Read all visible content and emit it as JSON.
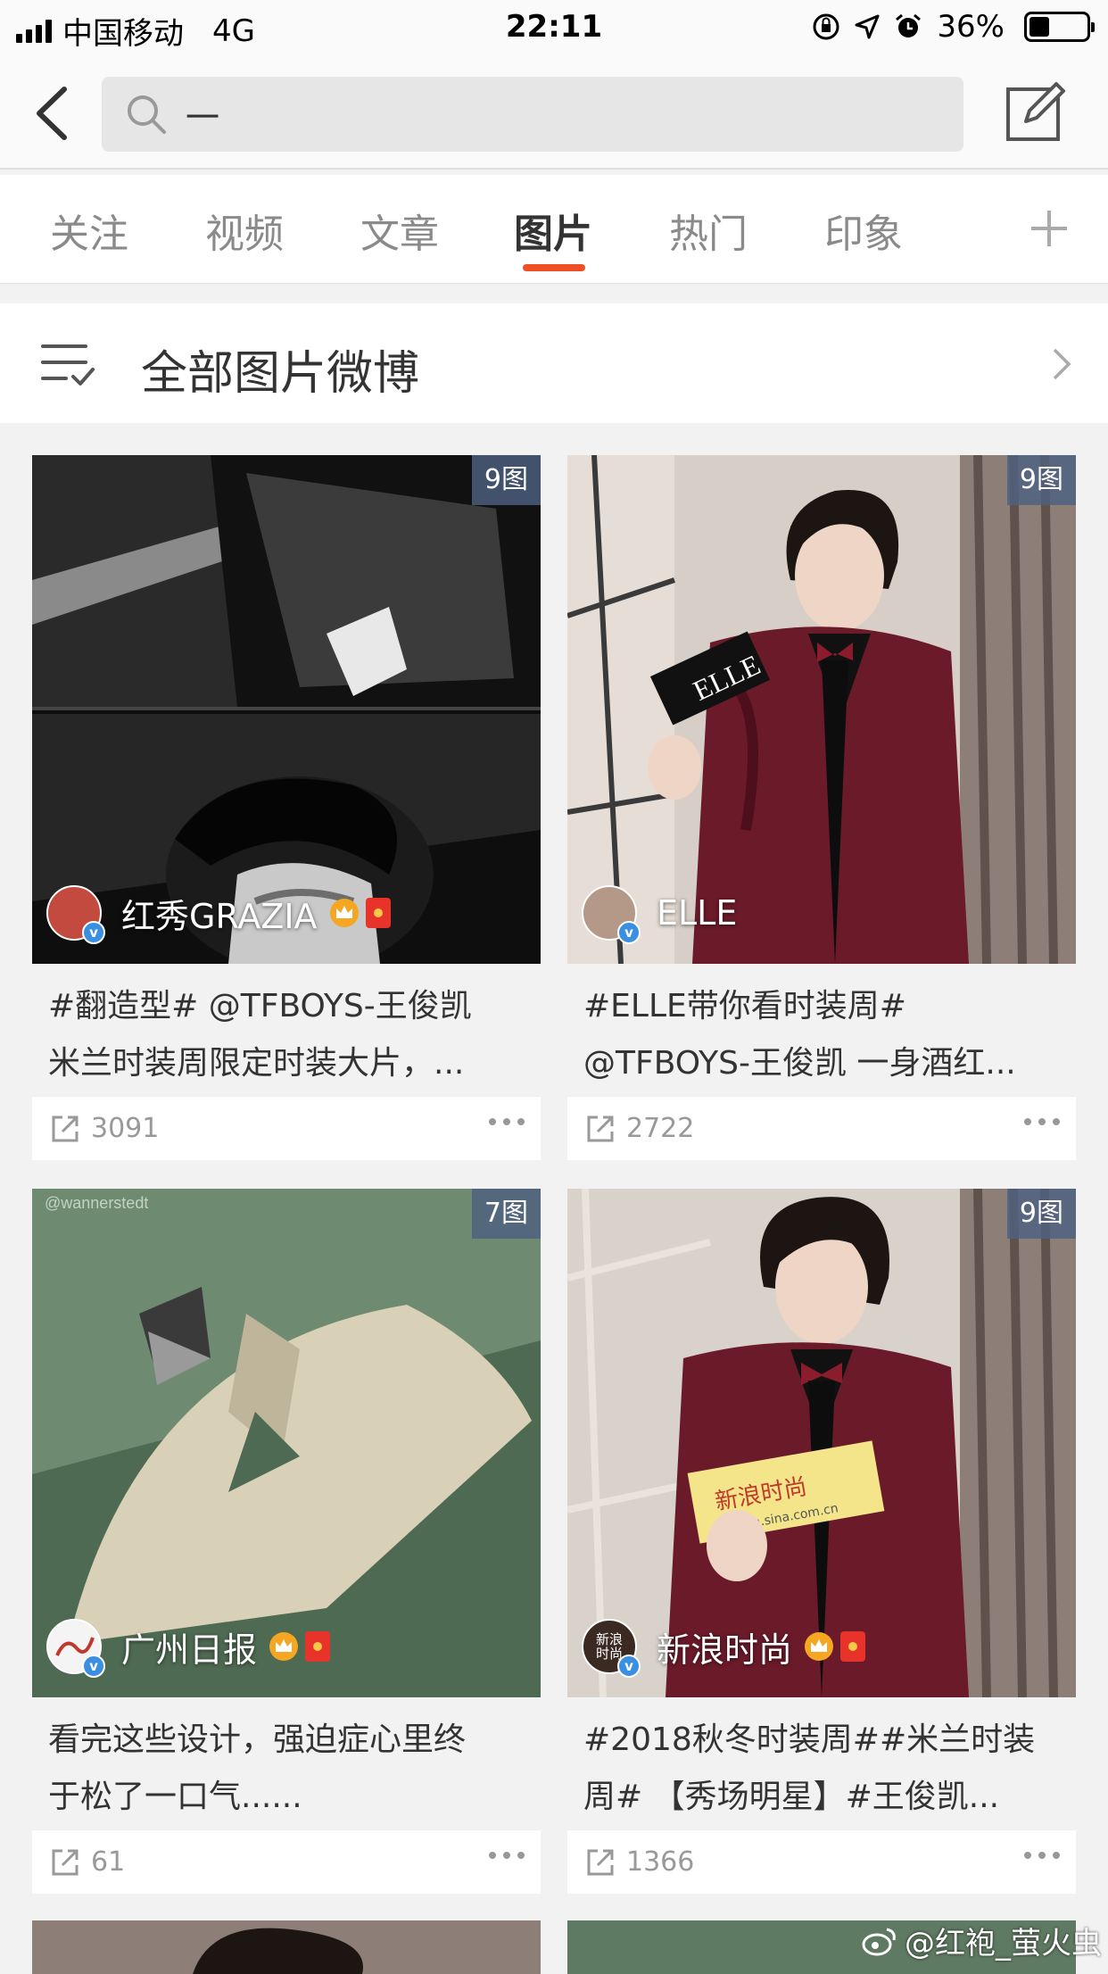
{
  "status_bar": {
    "carrier": "中国移动",
    "network": "4G",
    "time": "22:11",
    "battery": "36%",
    "battery_level": 0.36
  },
  "search": {
    "query": "一"
  },
  "tabs": [
    {
      "label": "关注"
    },
    {
      "label": "视频"
    },
    {
      "label": "文章"
    },
    {
      "label": "图片"
    },
    {
      "label": "热门"
    },
    {
      "label": "印象"
    }
  ],
  "active_tab": "图片",
  "filter": {
    "title": "全部图片微博"
  },
  "cards": [
    {
      "count_badge": "9图",
      "author": "红秀GRAZIA",
      "text_line1": "#翻造型# @TFBOYS-王俊凯",
      "text_line2": "米兰时装周限定时装大片，...",
      "shares": "3091"
    },
    {
      "count_badge": "9图",
      "author": "ELLE",
      "text_line1": "#ELLE带你看时装周#",
      "text_line2": "@TFBOYS-王俊凯 一身酒红...",
      "shares": "2722",
      "prop_text": "ELLE"
    },
    {
      "count_badge": "7图",
      "author": "广州日报",
      "text_line1": "看完这些设计，强迫症心里终",
      "text_line2": "于松了一口气......",
      "shares": "61",
      "image_watermark": "@wannerstedt"
    },
    {
      "count_badge": "9图",
      "author": "新浪时尚",
      "text_line1": "#2018秋冬时装周##米兰时装",
      "text_line2": "周# 【秀场明星】#王俊凯...",
      "shares": "1366",
      "prop_text": "新浪时尚",
      "prop_sub": "fashion.sina.com.cn",
      "avatar_text": "新浪时尚"
    }
  ],
  "watermark": "@红袍_萤火虫",
  "colors": {
    "accent": "#f04e23",
    "badge_bg": "#4e6080",
    "verified": "#3a8fe0"
  }
}
